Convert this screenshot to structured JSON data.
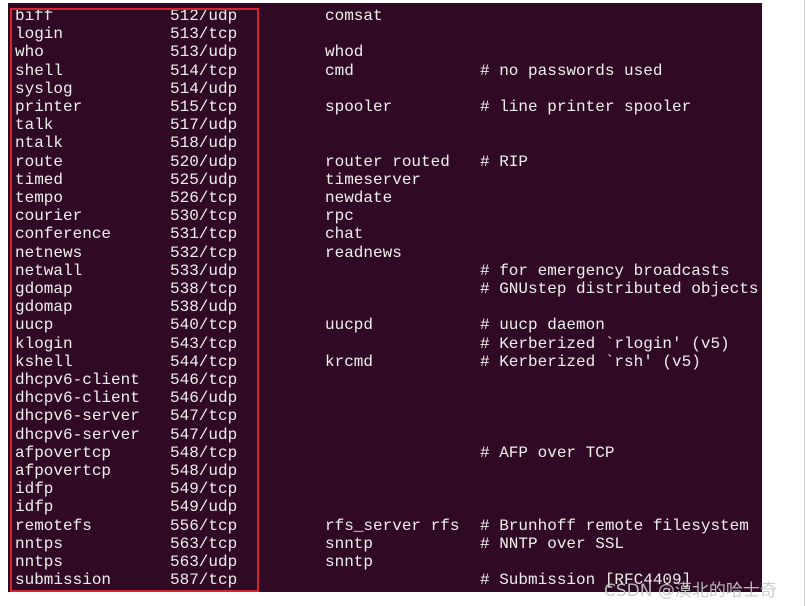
{
  "terminal": {
    "background": "#300a24",
    "highlight_color": "#d4262e",
    "rows": [
      [
        "biff",
        "512/udp",
        "comsat",
        ""
      ],
      [
        "login",
        "513/tcp",
        "",
        ""
      ],
      [
        "who",
        "513/udp",
        "whod",
        ""
      ],
      [
        "shell",
        "514/tcp",
        "cmd",
        "# no passwords used"
      ],
      [
        "syslog",
        "514/udp",
        "",
        ""
      ],
      [
        "printer",
        "515/tcp",
        "spooler",
        "# line printer spooler"
      ],
      [
        "talk",
        "517/udp",
        "",
        ""
      ],
      [
        "ntalk",
        "518/udp",
        "",
        ""
      ],
      [
        "route",
        "520/udp",
        "router routed",
        "# RIP"
      ],
      [
        "timed",
        "525/udp",
        "timeserver",
        ""
      ],
      [
        "tempo",
        "526/tcp",
        "newdate",
        ""
      ],
      [
        "courier",
        "530/tcp",
        "rpc",
        ""
      ],
      [
        "conference",
        "531/tcp",
        "chat",
        ""
      ],
      [
        "netnews",
        "532/tcp",
        "readnews",
        ""
      ],
      [
        "netwall",
        "533/udp",
        "",
        "# for emergency broadcasts"
      ],
      [
        "gdomap",
        "538/tcp",
        "",
        "# GNUstep distributed objects"
      ],
      [
        "gdomap",
        "538/udp",
        "",
        ""
      ],
      [
        "uucp",
        "540/tcp",
        "uucpd",
        "# uucp daemon"
      ],
      [
        "klogin",
        "543/tcp",
        "",
        "# Kerberized `rlogin' (v5)"
      ],
      [
        "kshell",
        "544/tcp",
        "krcmd",
        "# Kerberized `rsh' (v5)"
      ],
      [
        "dhcpv6-client",
        "546/tcp",
        "",
        ""
      ],
      [
        "dhcpv6-client",
        "546/udp",
        "",
        ""
      ],
      [
        "dhcpv6-server",
        "547/tcp",
        "",
        ""
      ],
      [
        "dhcpv6-server",
        "547/udp",
        "",
        ""
      ],
      [
        "afpovertcp",
        "548/tcp",
        "",
        "# AFP over TCP"
      ],
      [
        "afpovertcp",
        "548/udp",
        "",
        ""
      ],
      [
        "idfp",
        "549/tcp",
        "",
        ""
      ],
      [
        "idfp",
        "549/udp",
        "",
        ""
      ],
      [
        "remotefs",
        "556/tcp",
        "rfs_server rfs",
        "# Brunhoff remote filesystem"
      ],
      [
        "nntps",
        "563/tcp",
        "snntp",
        "# NNTP over SSL"
      ],
      [
        "nntps",
        "563/udp",
        "snntp",
        ""
      ],
      [
        "submission",
        "587/tcp",
        "",
        "# Submission [RFC4409]"
      ]
    ]
  },
  "watermark": "CSDN @漠北的哈士奇"
}
